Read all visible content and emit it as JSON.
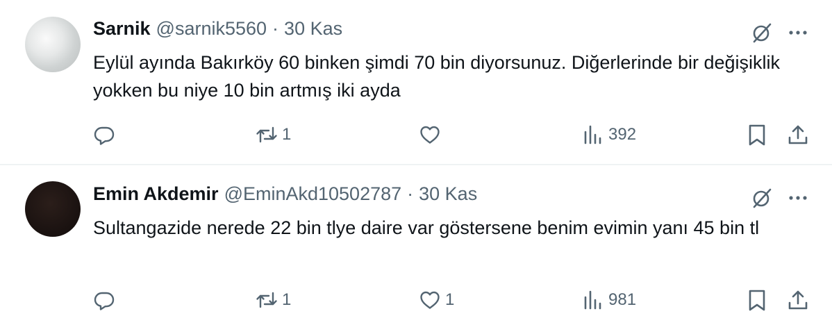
{
  "tweets": [
    {
      "name": "Sarnik",
      "handle": "@sarnik5560",
      "separator": "·",
      "date": "30 Kas",
      "text": "Eylül ayında Bakırköy 60 binken şimdi 70 bin diyorsunuz. Diğerlerinde bir değişiklik yokken bu niye 10 bin artmış iki ayda",
      "replies": "",
      "retweets": "1",
      "likes": "",
      "views": "392"
    },
    {
      "name": "Emin Akdemir",
      "handle": "@EminAkd10502787",
      "separator": "·",
      "date": "30 Kas",
      "text": "Sultangazide nerede 22 bin tlye daire var göstersene benim evimin yanı 45 bin tl",
      "replies": "",
      "retweets": "1",
      "likes": "1",
      "views": "981"
    }
  ],
  "icons": {
    "reply": "reply-icon",
    "retweet": "retweet-icon",
    "like": "heart-icon",
    "views": "views-icon",
    "bookmark": "bookmark-icon",
    "share": "share-icon",
    "grok": "grok-icon",
    "more": "more-icon"
  },
  "colors": {
    "text": "#0f1419",
    "muted": "#536471",
    "divider": "#eff3f4"
  }
}
